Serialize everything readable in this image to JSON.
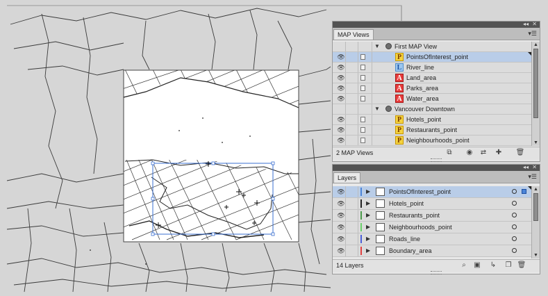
{
  "map_views_panel": {
    "tab_label": "MAP Views",
    "footer_text": "2 MAP Views",
    "groups": [
      {
        "name": "First MAP View",
        "layers": [
          {
            "label": "PointsOfInterest_point",
            "type": "P",
            "selected": true
          },
          {
            "label": "River_line",
            "type": "L",
            "selected": false
          },
          {
            "label": "Land_area",
            "type": "A",
            "selected": false
          },
          {
            "label": "Parks_area",
            "type": "A",
            "selected": false
          },
          {
            "label": "Water_area",
            "type": "A",
            "selected": false
          }
        ]
      },
      {
        "name": "Vancouver Downtown",
        "layers": [
          {
            "label": "Hotels_point",
            "type": "P",
            "selected": false
          },
          {
            "label": "Restaurants_point",
            "type": "P",
            "selected": false
          },
          {
            "label": "Neighbourhoods_point",
            "type": "P",
            "selected": false
          }
        ]
      }
    ]
  },
  "layers_panel": {
    "tab_label": "Layers",
    "footer_text": "14 Layers",
    "layers": [
      {
        "label": "PointsOfInterest_point",
        "color": "#4b84d8",
        "selected": true
      },
      {
        "label": "Hotels_point",
        "color": "#222222",
        "selected": false
      },
      {
        "label": "Restaurants_point",
        "color": "#4a9a4a",
        "selected": false
      },
      {
        "label": "Neighbourhoods_point",
        "color": "#6ad06a",
        "selected": false
      },
      {
        "label": "Roads_line",
        "color": "#4b5fd8",
        "selected": false
      },
      {
        "label": "Boundary_area",
        "color": "#e04040",
        "selected": false
      }
    ]
  },
  "icons": {
    "visibility": "eye-icon",
    "template": "document-icon",
    "group": "globe-icon",
    "expand": "disclosure-triangle-icon",
    "search": "search-icon",
    "delete": "trash-icon",
    "new_layer": "new-layer-icon",
    "menu": "panel-menu-icon"
  }
}
